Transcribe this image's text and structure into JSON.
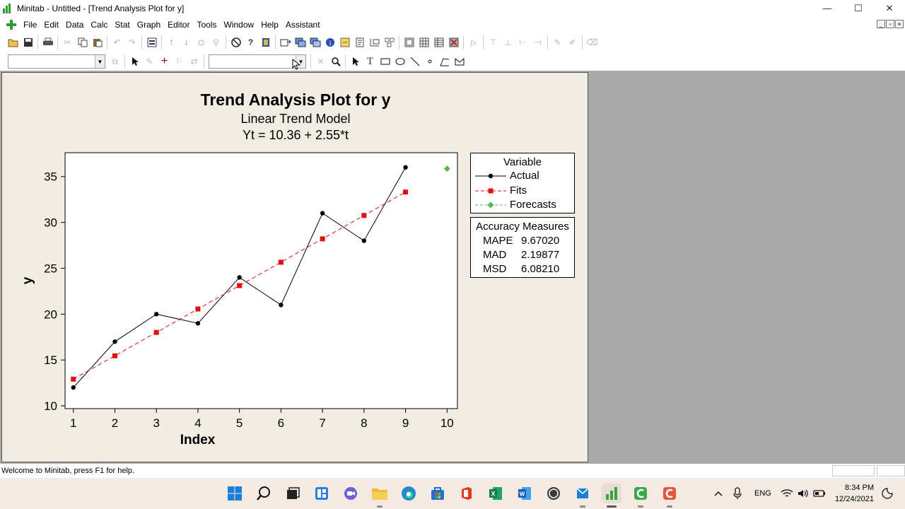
{
  "window": {
    "title": "Minitab - Untitled - [Trend Analysis Plot for y]",
    "controls": [
      "—",
      "☐",
      "✕"
    ]
  },
  "menu": {
    "items": [
      "File",
      "Edit",
      "Data",
      "Calc",
      "Stat",
      "Graph",
      "Editor",
      "Tools",
      "Window",
      "Help",
      "Assistant"
    ]
  },
  "toolbar1": {
    "icons": [
      "open-icon",
      "save-icon",
      "print-icon",
      "cut-icon",
      "copy-icon",
      "paste-icon",
      "undo-icon",
      "redo-icon",
      "edit-last-dialog-icon",
      "previous-icon",
      "next-icon",
      "find-icon",
      "replace-icon",
      "cancel-icon",
      "help-icon",
      "stat-guide-icon",
      "session-icon",
      "worksheet-icon",
      "graphs-icon",
      "info-icon",
      "history-icon",
      "report-icon",
      "new-graph-icon",
      "manage-graphs-icon",
      "layout-icon",
      "grid-icon",
      "table-icon",
      "close-graphs-icon",
      "formula-icon",
      "insert-row-icon",
      "delete-row-icon",
      "move-row-icon",
      "move-col-icon",
      "brush-icon",
      "brush-set-icon",
      "eraser-icon"
    ]
  },
  "toolbar2": {
    "icons": [
      "select-icon",
      "brush-icon",
      "crosshairs-icon",
      "flag-icon",
      "swap-icon",
      "delete-icon",
      "zoom-icon",
      "arrow-tool-icon",
      "text-tool-icon",
      "rectangle-tool-icon",
      "ellipse-tool-icon",
      "line-tool-icon",
      "marker-tool-icon",
      "polyline-tool-icon",
      "polygon-tool-icon"
    ]
  },
  "graph": {
    "title": "Trend Analysis Plot for y",
    "subtitle": "Linear Trend Model",
    "equation": "Yt = 10.36 + 2.55*t"
  },
  "chart_data": {
    "type": "line",
    "title": "Trend Analysis Plot for y",
    "subtitle": "Linear Trend Model",
    "xlabel": "Index",
    "ylabel": "y",
    "x_ticks": [
      "1",
      "2",
      "3",
      "4",
      "5",
      "6",
      "7",
      "8",
      "9",
      "10"
    ],
    "y_ticks": [
      "10",
      "15",
      "20",
      "25",
      "30",
      "35"
    ],
    "xlim": [
      0.8,
      10.25
    ],
    "ylim": [
      9.7,
      37.6
    ],
    "series": [
      {
        "name": "Actual",
        "color": "#000000",
        "marker": "circle",
        "dashed": false,
        "x": [
          1,
          2,
          3,
          4,
          5,
          6,
          7,
          8,
          9
        ],
        "y": [
          12,
          17,
          20,
          19,
          24,
          21,
          31,
          28,
          36
        ]
      },
      {
        "name": "Fits",
        "color": "#e01010",
        "marker": "square",
        "dashed": true,
        "x": [
          1,
          2,
          3,
          4,
          5,
          6,
          7,
          8,
          9
        ],
        "y": [
          12.91,
          15.46,
          18.01,
          20.56,
          23.11,
          25.66,
          28.21,
          30.76,
          33.31
        ]
      },
      {
        "name": "Forecasts",
        "color": "#55bb44",
        "marker": "diamond",
        "dashed": true,
        "x": [
          10
        ],
        "y": [
          35.86
        ]
      }
    ],
    "legend": {
      "title": "Variable",
      "placement": "right"
    }
  },
  "accuracy": {
    "title": "Accuracy Measures",
    "rows": [
      {
        "label": "MAPE",
        "value": "9.67020"
      },
      {
        "label": "MAD",
        "value": "2.19877"
      },
      {
        "label": "MSD",
        "value": "6.08210"
      }
    ]
  },
  "status": {
    "message": "Welcome to Minitab, press F1 for help."
  },
  "taskbar": {
    "apps": [
      "windows-start-icon",
      "search-icon",
      "task-view-icon",
      "widgets-icon",
      "chat-icon",
      "file-explorer-icon",
      "edge-icon",
      "store-icon",
      "office-icon",
      "excel-icon",
      "word-icon",
      "whatsapp-icon",
      "outlook-icon",
      "minitab-icon",
      "camtasia-icon",
      "recorder-icon"
    ],
    "language": "ENG",
    "time": "8:34 PM",
    "date": "12/24/2021"
  }
}
